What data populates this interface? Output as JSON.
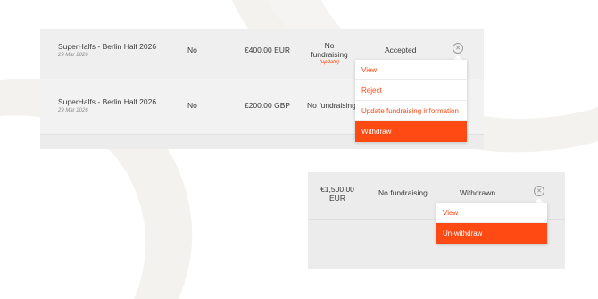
{
  "panel_a": {
    "rows": [
      {
        "event_name": "SuperHalfs - Berlin Half 2026",
        "event_date": "29 Mar 2026",
        "flag": "No",
        "amount": "€400.00 EUR",
        "fundraising": "No fundraising",
        "fundraising_link": "(update)",
        "status": "Accepted"
      },
      {
        "event_name": "SuperHalfs - Berlin Half 2026",
        "event_date": "29 Mar 2026",
        "flag": "No",
        "amount": "£200.00 GBP",
        "fundraising": "No fundraising"
      }
    ],
    "menu": {
      "items": [
        "View",
        "Reject",
        "Update fundraising information"
      ],
      "primary": "Withdraw"
    }
  },
  "panel_b": {
    "row": {
      "amount": "€1,500.00 EUR",
      "fundraising": "No fundraising",
      "status": "Withdrawn"
    },
    "menu": {
      "items": [
        "View"
      ],
      "primary": "Un-withdraw"
    }
  },
  "colors": {
    "accent": "#ff4a14",
    "panel_bg": "#ececec",
    "swirl": "#f4f2ef"
  },
  "icons": {
    "row_action": "close-circle-icon"
  }
}
